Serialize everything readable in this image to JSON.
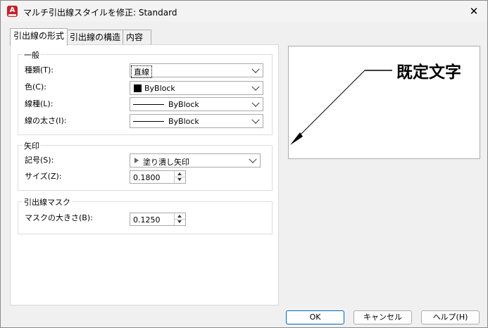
{
  "window": {
    "title": "マルチ引出線スタイルを修正: Standard",
    "icon_letter": "A"
  },
  "tabs": [
    {
      "label": "引出線の形式",
      "active": true
    },
    {
      "label": "引出線の構造",
      "active": false
    },
    {
      "label": "内容",
      "active": false
    }
  ],
  "general": {
    "title": "一般",
    "type_label": "種類(T):",
    "type_value": "直線",
    "color_label": "色(C):",
    "color_value": "ByBlock",
    "linetype_label": "線種(L):",
    "linetype_value": "ByBlock",
    "lineweight_label": "線の太さ(I):",
    "lineweight_value": "ByBlock"
  },
  "arrowhead": {
    "title": "矢印",
    "symbol_label": "記号(S):",
    "symbol_value": "塗り潰し矢印",
    "size_label": "サイズ(Z):",
    "size_value": "0.1800"
  },
  "leader_break": {
    "title": "引出線マスク",
    "size_label": "マスクの大きさ(B):",
    "size_value": "0.1250"
  },
  "preview": {
    "text": "既定文字"
  },
  "buttons": {
    "ok": "OK",
    "cancel": "キャンセル",
    "help": "ヘルプ(H)"
  },
  "colors": {
    "accent_border": "#0067c0",
    "app_icon": "#c8202a",
    "swatch": "#000000"
  }
}
